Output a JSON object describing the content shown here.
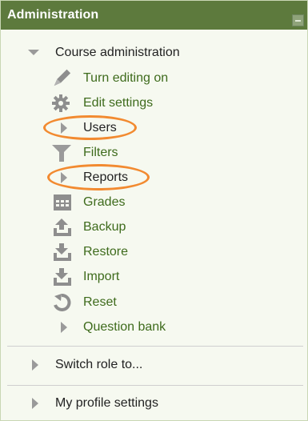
{
  "header": {
    "title": "Administration"
  },
  "course_admin": {
    "label": "Course administration",
    "items": [
      {
        "label": "Turn editing on",
        "icon": "pencil-icon"
      },
      {
        "label": "Edit settings",
        "icon": "gear-icon"
      },
      {
        "label": "Users",
        "icon": "triangle-right-icon",
        "highlighted": true
      },
      {
        "label": "Filters",
        "icon": "funnel-icon"
      },
      {
        "label": "Reports",
        "icon": "triangle-right-icon",
        "highlighted": true
      },
      {
        "label": "Grades",
        "icon": "grid-table-icon"
      },
      {
        "label": "Backup",
        "icon": "upload-tray-icon"
      },
      {
        "label": "Restore",
        "icon": "download-tray-icon"
      },
      {
        "label": "Import",
        "icon": "download-tray-icon"
      },
      {
        "label": "Reset",
        "icon": "reset-arrow-icon"
      },
      {
        "label": "Question bank",
        "icon": "triangle-right-icon"
      }
    ]
  },
  "switch_role": {
    "label": "Switch role to..."
  },
  "profile_settings": {
    "label": "My profile settings"
  },
  "colors": {
    "header_bg": "#5d7a3d",
    "link_green": "#3e6b1c",
    "highlight_orange": "#f28a30",
    "icon_grey": "#9a9a9a"
  }
}
